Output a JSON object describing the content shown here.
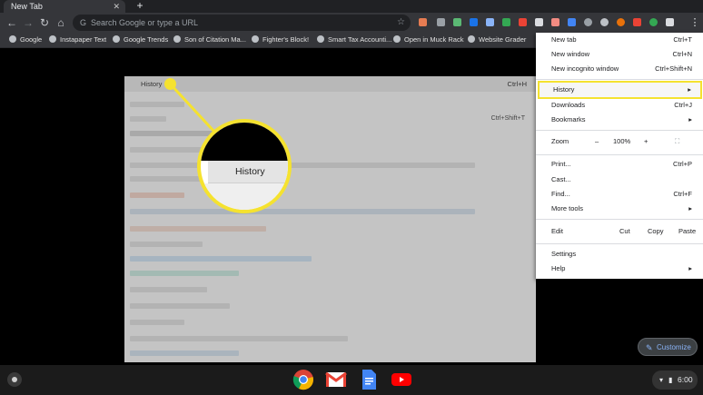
{
  "browser": {
    "tab_title": "New Tab",
    "tab_close": "✕",
    "new_tab": "+",
    "omnibox_placeholder": "Search Google or type a URL",
    "nav": {
      "back": "←",
      "forward": "→",
      "reload": "↻",
      "home": "⌂"
    },
    "star": "☆",
    "menu_icon": "⋮"
  },
  "bookmarks": [
    {
      "label": "Google"
    },
    {
      "label": "Instapaper Text"
    },
    {
      "label": "Google Trends"
    },
    {
      "label": "Son of Citation Ma..."
    },
    {
      "label": "Fighter's Block!"
    },
    {
      "label": "Smart Tax Accounti..."
    },
    {
      "label": "Open in Muck Rack"
    },
    {
      "label": "Website Grader"
    }
  ],
  "panel": {
    "history_label": "History",
    "history_shortcut": "Ctrl+H",
    "downloads_shortcut": "Ctrl+Shift+T"
  },
  "magnifier": {
    "label": "History"
  },
  "menu": {
    "new_tab": {
      "label": "New tab",
      "shortcut": "Ctrl+T"
    },
    "new_window": {
      "label": "New window",
      "shortcut": "Ctrl+N"
    },
    "incognito": {
      "label": "New incognito window",
      "shortcut": "Ctrl+Shift+N"
    },
    "history": {
      "label": "History",
      "arrow": "▸"
    },
    "downloads": {
      "label": "Downloads",
      "shortcut": "Ctrl+J"
    },
    "bookmarks": {
      "label": "Bookmarks",
      "arrow": "▸"
    },
    "zoom": {
      "label": "Zoom",
      "minus": "–",
      "value": "100%",
      "plus": "+",
      "fullscreen": "⛶"
    },
    "print": {
      "label": "Print...",
      "shortcut": "Ctrl+P"
    },
    "cast": {
      "label": "Cast..."
    },
    "find": {
      "label": "Find...",
      "shortcut": "Ctrl+F"
    },
    "more_tools": {
      "label": "More tools",
      "arrow": "▸"
    },
    "edit": {
      "label": "Edit",
      "cut": "Cut",
      "copy": "Copy",
      "paste": "Paste"
    },
    "settings": {
      "label": "Settings"
    },
    "help": {
      "label": "Help",
      "arrow": "▸"
    }
  },
  "customize": {
    "label": "Customize",
    "icon": "✎"
  },
  "shelf": {
    "time": "6:00",
    "wifi_icon": "▾",
    "battery_icon": "▮"
  },
  "colors": {
    "highlight": "#f5e22f",
    "toolbar": "#35363a",
    "menu_bg": "#ffffff"
  }
}
